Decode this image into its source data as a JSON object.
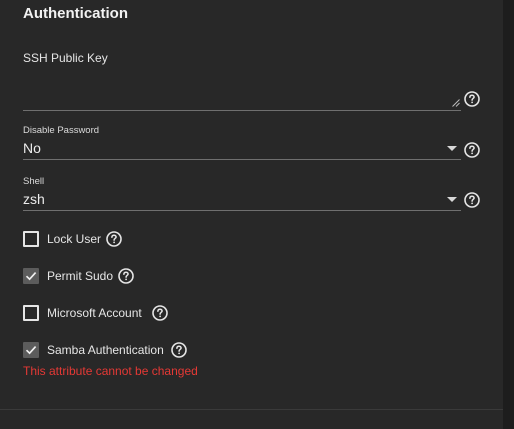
{
  "section": {
    "title": "Authentication"
  },
  "ssh_key": {
    "label": "SSH Public Key",
    "value": ""
  },
  "disable_password": {
    "label": "Disable Password",
    "value": "No"
  },
  "shell": {
    "label": "Shell",
    "value": "zsh"
  },
  "checkboxes": [
    {
      "label": "Lock User",
      "checked": false
    },
    {
      "label": "Permit Sudo",
      "checked": true
    },
    {
      "label": "Microsoft Account",
      "checked": false
    },
    {
      "label": "Samba Authentication",
      "checked": true
    }
  ],
  "error_message": "This attribute cannot be changed",
  "icons": {
    "help": "help-circle-icon",
    "check": "check-icon",
    "caret": "caret-down-icon",
    "resize": "resize-grip-icon"
  },
  "colors": {
    "background": "#282828",
    "error": "#e53935",
    "checked_box": "#5c5c5c"
  }
}
